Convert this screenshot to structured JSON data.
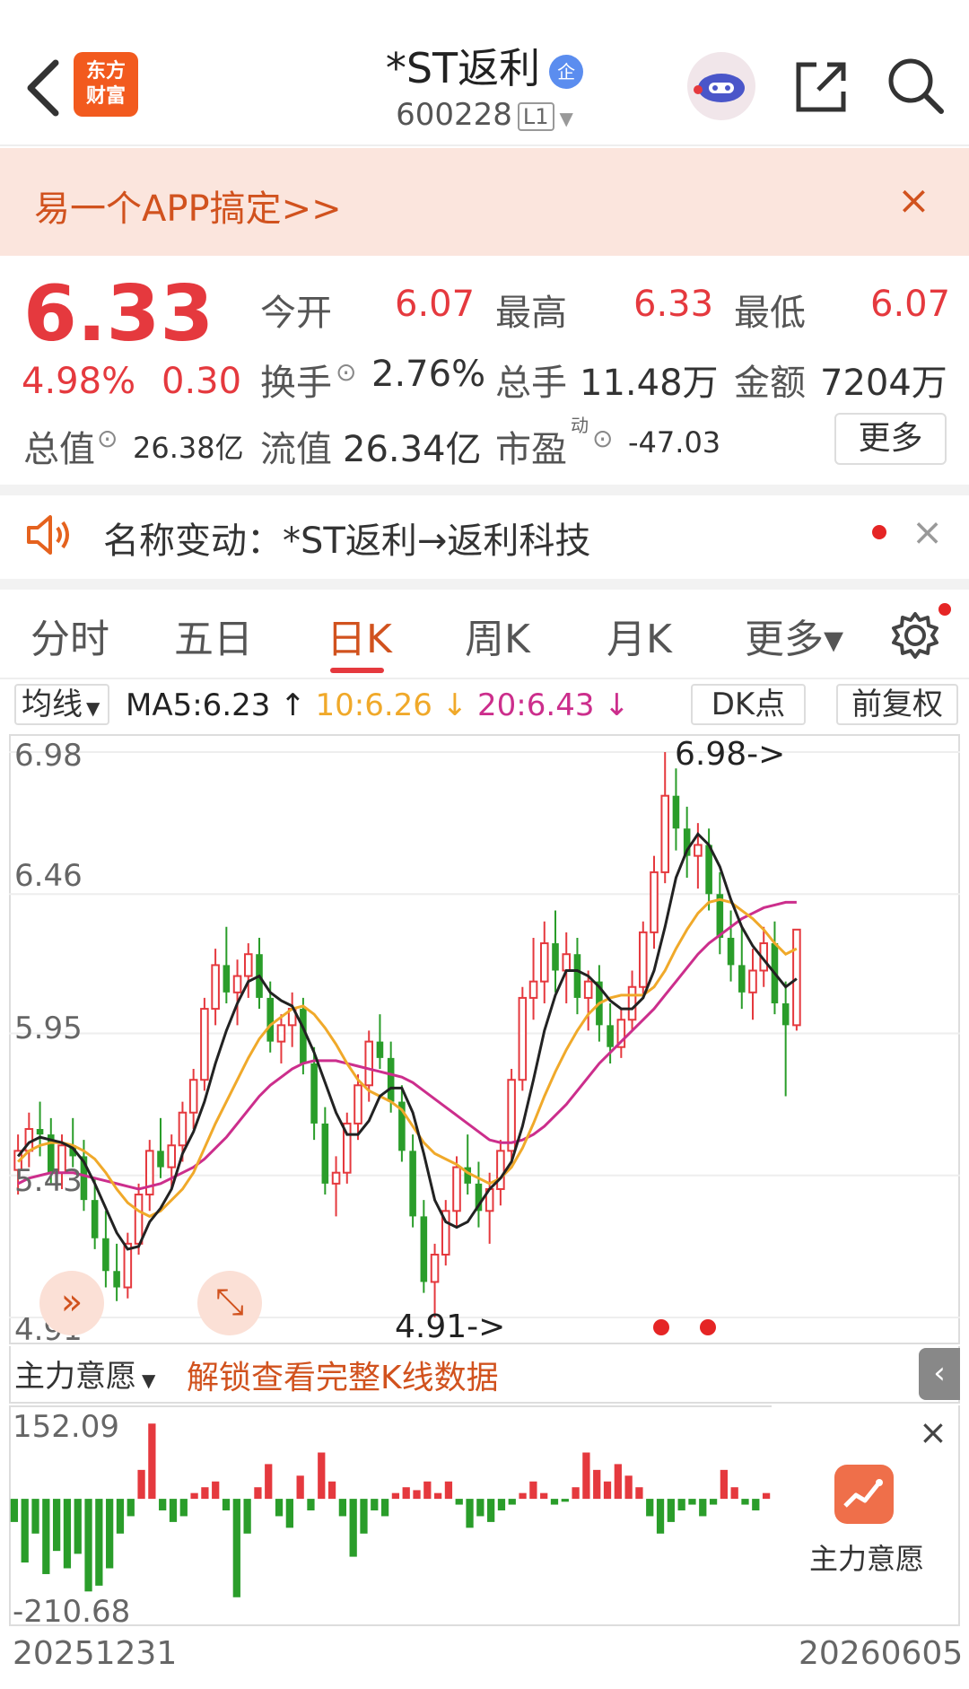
{
  "header": {
    "logo_line1": "东方",
    "logo_line2": "财富",
    "title": "*ST返利",
    "badge": "企",
    "code": "600228",
    "level": "L1"
  },
  "banner": {
    "text": "易一个APP搞定>>",
    "close": "×"
  },
  "quote": {
    "price": "6.33",
    "change_pct": "4.98%",
    "change": "0.30",
    "open_label": "今开",
    "open": "6.07",
    "high_label": "最高",
    "high": "6.33",
    "low_label": "最低",
    "low": "6.07",
    "turnover_label": "换手",
    "turnover": "2.76%",
    "volume_label": "总手",
    "volume": "11.48万",
    "amount_label": "金额",
    "amount": "7204万",
    "mktcap_label": "总值",
    "mktcap": "26.38亿",
    "float_label": "流值",
    "float": "26.34亿",
    "pe_label": "市盈",
    "pe_sup": "动",
    "pe": "-47.03",
    "more": "更多"
  },
  "notice": {
    "text": "名称变动：*ST返利→返利科技",
    "close": "×"
  },
  "tabs": [
    {
      "label": "分时"
    },
    {
      "label": "五日"
    },
    {
      "label": "日K"
    },
    {
      "label": "周K"
    },
    {
      "label": "月K"
    },
    {
      "label": "更多▾"
    }
  ],
  "ma_bar": {
    "select": "均线",
    "ma5": "MA5:6.23 ↑",
    "ma10": "10:6.26 ↓",
    "ma20": "20:6.43 ↓",
    "dk": "DK点",
    "fq": "前复权"
  },
  "colors": {
    "up": "#e5393e",
    "down": "#2a9d2a",
    "ma5": "#222222",
    "ma10": "#f0a92a",
    "ma20": "#cc2e8c",
    "accent": "#d1521e"
  },
  "chart_data": {
    "type": "candlestick",
    "y_ticks": [
      "6.98",
      "6.46",
      "5.95",
      "5.43",
      "4.91"
    ],
    "ylim": [
      4.91,
      6.98
    ],
    "high_marker": "6.98->",
    "low_marker": "4.91->",
    "date_start": "20251231",
    "date_end": "20260605",
    "ohlc": [
      [
        5.45,
        5.58,
        5.36,
        5.52
      ],
      [
        5.52,
        5.66,
        5.46,
        5.6
      ],
      [
        5.6,
        5.7,
        5.5,
        5.58
      ],
      [
        5.58,
        5.64,
        5.4,
        5.44
      ],
      [
        5.44,
        5.58,
        5.38,
        5.54
      ],
      [
        5.54,
        5.64,
        5.46,
        5.5
      ],
      [
        5.5,
        5.56,
        5.3,
        5.34
      ],
      [
        5.34,
        5.42,
        5.16,
        5.2
      ],
      [
        5.2,
        5.3,
        5.02,
        5.08
      ],
      [
        5.08,
        5.18,
        4.97,
        5.02
      ],
      [
        5.02,
        5.22,
        4.98,
        5.18
      ],
      [
        5.18,
        5.4,
        5.14,
        5.36
      ],
      [
        5.36,
        5.56,
        5.3,
        5.52
      ],
      [
        5.52,
        5.64,
        5.42,
        5.46
      ],
      [
        5.46,
        5.58,
        5.38,
        5.54
      ],
      [
        5.54,
        5.7,
        5.48,
        5.66
      ],
      [
        5.66,
        5.82,
        5.6,
        5.78
      ],
      [
        5.78,
        6.08,
        5.74,
        6.04
      ],
      [
        6.04,
        6.26,
        5.98,
        6.2
      ],
      [
        6.2,
        6.34,
        6.06,
        6.1
      ],
      [
        6.1,
        6.22,
        5.98,
        6.16
      ],
      [
        6.16,
        6.28,
        6.08,
        6.24
      ],
      [
        6.24,
        6.3,
        6.04,
        6.08
      ],
      [
        6.08,
        6.14,
        5.88,
        5.92
      ],
      [
        5.92,
        6.02,
        5.84,
        5.98
      ],
      [
        5.98,
        6.1,
        5.9,
        6.04
      ],
      [
        6.04,
        6.08,
        5.8,
        5.84
      ],
      [
        5.84,
        5.9,
        5.56,
        5.62
      ],
      [
        5.62,
        5.68,
        5.36,
        5.4
      ],
      [
        5.4,
        5.5,
        5.28,
        5.44
      ],
      [
        5.44,
        5.66,
        5.4,
        5.62
      ],
      [
        5.62,
        5.8,
        5.56,
        5.76
      ],
      [
        5.76,
        5.96,
        5.7,
        5.92
      ],
      [
        5.92,
        6.02,
        5.82,
        5.86
      ],
      [
        5.86,
        5.92,
        5.66,
        5.7
      ],
      [
        5.7,
        5.76,
        5.48,
        5.52
      ],
      [
        5.52,
        5.58,
        5.24,
        5.28
      ],
      [
        5.28,
        5.34,
        5.0,
        5.04
      ],
      [
        5.04,
        5.18,
        4.91,
        5.14
      ],
      [
        5.14,
        5.34,
        5.1,
        5.3
      ],
      [
        5.3,
        5.5,
        5.24,
        5.46
      ],
      [
        5.46,
        5.58,
        5.36,
        5.4
      ],
      [
        5.4,
        5.48,
        5.24,
        5.3
      ],
      [
        5.3,
        5.44,
        5.18,
        5.38
      ],
      [
        5.38,
        5.56,
        5.32,
        5.52
      ],
      [
        5.52,
        5.82,
        5.48,
        5.78
      ],
      [
        5.78,
        6.12,
        5.74,
        6.08
      ],
      [
        6.08,
        6.3,
        6.0,
        6.14
      ],
      [
        6.14,
        6.36,
        6.06,
        6.28
      ],
      [
        6.28,
        6.4,
        6.1,
        6.18
      ],
      [
        6.18,
        6.32,
        6.06,
        6.24
      ],
      [
        6.24,
        6.3,
        6.02,
        6.08
      ],
      [
        6.08,
        6.18,
        5.96,
        6.14
      ],
      [
        6.14,
        6.2,
        5.92,
        5.98
      ],
      [
        5.98,
        6.06,
        5.84,
        5.9
      ],
      [
        5.9,
        6.04,
        5.86,
        6.0
      ],
      [
        6.0,
        6.18,
        5.96,
        6.12
      ],
      [
        6.12,
        6.36,
        6.08,
        6.32
      ],
      [
        6.32,
        6.6,
        6.26,
        6.54
      ],
      [
        6.54,
        6.98,
        6.5,
        6.82
      ],
      [
        6.82,
        6.92,
        6.62,
        6.7
      ],
      [
        6.7,
        6.78,
        6.52,
        6.6
      ],
      [
        6.6,
        6.72,
        6.48,
        6.64
      ],
      [
        6.64,
        6.7,
        6.4,
        6.46
      ],
      [
        6.46,
        6.54,
        6.24,
        6.3
      ],
      [
        6.3,
        6.4,
        6.14,
        6.2
      ],
      [
        6.2,
        6.34,
        6.04,
        6.1
      ],
      [
        6.1,
        6.26,
        6.0,
        6.18
      ],
      [
        6.18,
        6.34,
        6.12,
        6.28
      ],
      [
        6.28,
        6.36,
        6.02,
        6.06
      ],
      [
        6.06,
        6.14,
        5.72,
        5.98
      ],
      [
        5.98,
        6.3,
        5.96,
        6.33
      ]
    ],
    "ma5": [
      5.5,
      5.55,
      5.57,
      5.56,
      5.55,
      5.53,
      5.48,
      5.4,
      5.31,
      5.22,
      5.16,
      5.17,
      5.26,
      5.31,
      5.38,
      5.51,
      5.59,
      5.7,
      5.84,
      5.96,
      6.06,
      6.14,
      6.16,
      6.1,
      6.07,
      6.05,
      5.97,
      5.88,
      5.77,
      5.66,
      5.58,
      5.58,
      5.63,
      5.72,
      5.75,
      5.75,
      5.66,
      5.51,
      5.34,
      5.26,
      5.24,
      5.26,
      5.32,
      5.38,
      5.42,
      5.48,
      5.61,
      5.78,
      5.96,
      6.09,
      6.18,
      6.18,
      6.16,
      6.12,
      6.07,
      6.04,
      6.04,
      6.08,
      6.18,
      6.34,
      6.52,
      6.62,
      6.68,
      6.64,
      6.56,
      6.44,
      6.34,
      6.27,
      6.22,
      6.17,
      6.12,
      6.15
    ],
    "ma10": [
      5.48,
      5.52,
      5.54,
      5.55,
      5.55,
      5.54,
      5.52,
      5.49,
      5.44,
      5.38,
      5.33,
      5.3,
      5.28,
      5.3,
      5.34,
      5.38,
      5.44,
      5.53,
      5.62,
      5.7,
      5.78,
      5.86,
      5.93,
      5.98,
      6.01,
      6.04,
      6.05,
      6.02,
      5.97,
      5.91,
      5.84,
      5.78,
      5.74,
      5.72,
      5.7,
      5.67,
      5.61,
      5.55,
      5.51,
      5.49,
      5.47,
      5.44,
      5.42,
      5.4,
      5.42,
      5.46,
      5.53,
      5.62,
      5.72,
      5.81,
      5.89,
      5.96,
      6.02,
      6.06,
      6.08,
      6.09,
      6.09,
      6.09,
      6.12,
      6.18,
      6.26,
      6.33,
      6.39,
      6.43,
      6.44,
      6.43,
      6.4,
      6.37,
      6.33,
      6.28,
      6.24,
      6.26
    ],
    "ma20": [
      5.4,
      5.42,
      5.43,
      5.44,
      5.44,
      5.44,
      5.43,
      5.42,
      5.41,
      5.4,
      5.39,
      5.38,
      5.39,
      5.4,
      5.42,
      5.44,
      5.46,
      5.49,
      5.53,
      5.57,
      5.62,
      5.67,
      5.72,
      5.76,
      5.79,
      5.82,
      5.84,
      5.85,
      5.85,
      5.85,
      5.84,
      5.83,
      5.82,
      5.81,
      5.8,
      5.79,
      5.77,
      5.74,
      5.71,
      5.68,
      5.65,
      5.62,
      5.59,
      5.56,
      5.55,
      5.55,
      5.56,
      5.58,
      5.61,
      5.65,
      5.69,
      5.74,
      5.79,
      5.84,
      5.88,
      5.92,
      5.96,
      6.0,
      6.04,
      6.09,
      6.14,
      6.19,
      6.24,
      6.28,
      6.31,
      6.34,
      6.37,
      6.39,
      6.41,
      6.42,
      6.43,
      6.43
    ]
  },
  "indicator": {
    "select": "主力意愿",
    "unlock": "解锁查看完整K线数据",
    "max": "152.09",
    "min": "-210.68",
    "panel_label": "主力意愿",
    "close": "×",
    "values": [
      -40,
      -110,
      -60,
      -130,
      -90,
      -120,
      -95,
      -160,
      -150,
      -120,
      -60,
      -30,
      50,
      130,
      -20,
      -40,
      -30,
      10,
      20,
      30,
      -20,
      -170,
      -60,
      20,
      60,
      -30,
      -50,
      40,
      -20,
      80,
      30,
      -30,
      -100,
      -60,
      -20,
      -30,
      10,
      20,
      15,
      30,
      10,
      30,
      -10,
      -50,
      -30,
      -40,
      -20,
      -10,
      10,
      30,
      10,
      -10,
      -5,
      20,
      80,
      50,
      30,
      60,
      40,
      20,
      -30,
      -60,
      -40,
      -20,
      -10,
      -30,
      -10,
      50,
      20,
      -10,
      -20,
      10
    ]
  }
}
